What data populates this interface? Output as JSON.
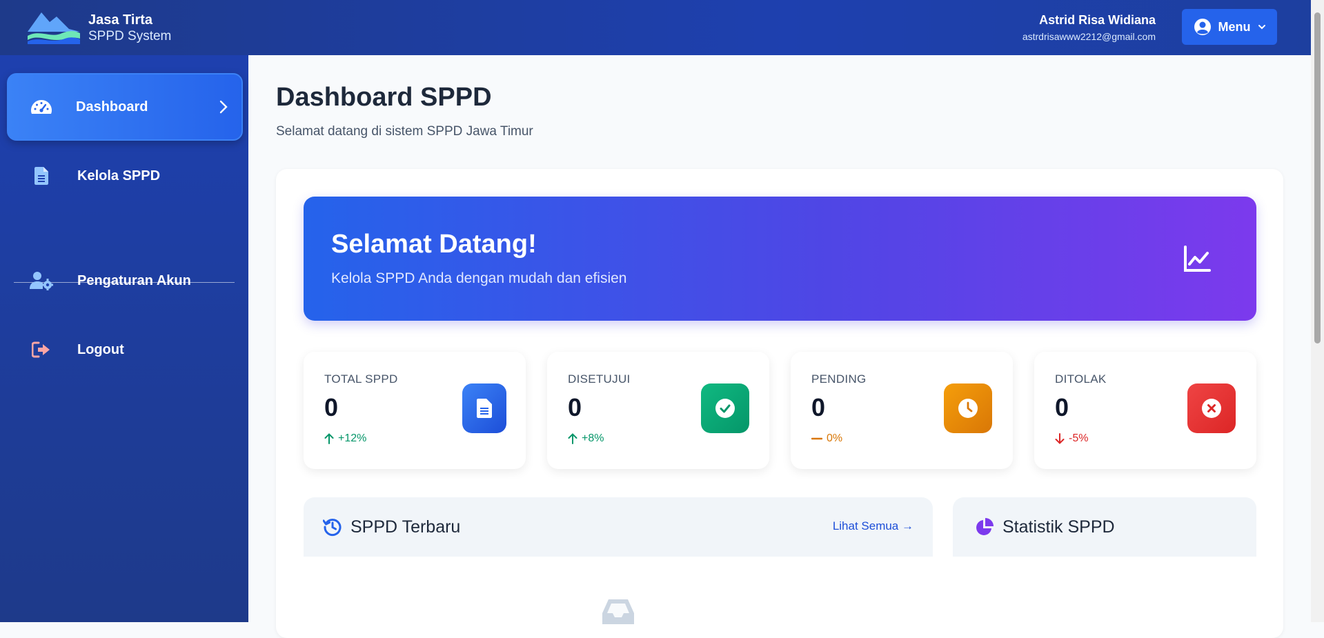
{
  "header": {
    "brand_title": "Jasa Tirta",
    "brand_subtitle": "SPPD System",
    "user_name": "Astrid Risa Widiana",
    "user_email": "astrdrisawww2212@gmail.com",
    "menu_label": "Menu"
  },
  "sidebar": {
    "items": [
      {
        "label": "Dashboard",
        "icon": "gauge-icon",
        "active": true
      },
      {
        "label": "Kelola SPPD",
        "icon": "document-icon",
        "active": false
      },
      {
        "label": "Pengaturan Akun",
        "icon": "user-settings-icon",
        "active": false
      },
      {
        "label": "Logout",
        "icon": "logout-icon",
        "active": false
      }
    ]
  },
  "main": {
    "title": "Dashboard SPPD",
    "subtitle": "Selamat datang di sistem SPPD Jawa Timur",
    "hero": {
      "title": "Selamat Datang!",
      "subtitle": "Kelola SPPD Anda dengan mudah dan efisien",
      "icon": "chart-line-icon"
    },
    "stats": [
      {
        "label": "TOTAL SPPD",
        "value": "0",
        "trend": "+12%",
        "trend_dir": "up",
        "trend_color": "#059669",
        "badge_color": "#2563eb",
        "icon": "document-icon"
      },
      {
        "label": "DISETUJUI",
        "value": "0",
        "trend": "+8%",
        "trend_dir": "up",
        "trend_color": "#059669",
        "badge_color": "#059669",
        "icon": "check-circle-icon"
      },
      {
        "label": "PENDING",
        "value": "0",
        "trend": "0%",
        "trend_dir": "flat",
        "trend_color": "#d97706",
        "badge_color": "#d97706",
        "icon": "clock-icon"
      },
      {
        "label": "DITOLAK",
        "value": "0",
        "trend": "-5%",
        "trend_dir": "down",
        "trend_color": "#dc2626",
        "badge_color": "#dc2626",
        "icon": "x-circle-icon"
      }
    ],
    "recent_panel": {
      "title": "SPPD Terbaru",
      "link": "Lihat Semua →",
      "icon": "history-icon"
    },
    "stats_panel": {
      "title": "Statistik SPPD",
      "icon": "pie-chart-icon"
    }
  },
  "colors": {
    "header_bg": "#1e40af",
    "sidebar_bg": "#1e3a8a",
    "accent": "#2563eb",
    "hero_gradient": [
      "#2563eb",
      "#7c3aed"
    ]
  }
}
